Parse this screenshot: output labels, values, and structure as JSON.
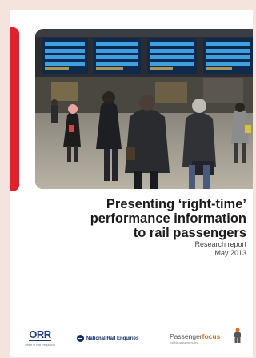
{
  "cover": {
    "title_lines": [
      "Presenting ‘right-time’",
      "performance information",
      "to rail passengers"
    ],
    "report_type": "Research report",
    "date": "May 2013"
  },
  "logos": {
    "orr": {
      "mark": "ORR",
      "subtitle": "Office of Rail Regulation"
    },
    "nre": {
      "name": "National Rail Enquiries"
    },
    "pf": {
      "text_part1": "Passenger",
      "text_part2": "focus",
      "tagline": "putting passengers first"
    }
  },
  "colors": {
    "accent_red": "#e0232a",
    "background": "#f4e4dd",
    "focus_orange": "#e06a1b",
    "navy": "#0d2d6b"
  }
}
